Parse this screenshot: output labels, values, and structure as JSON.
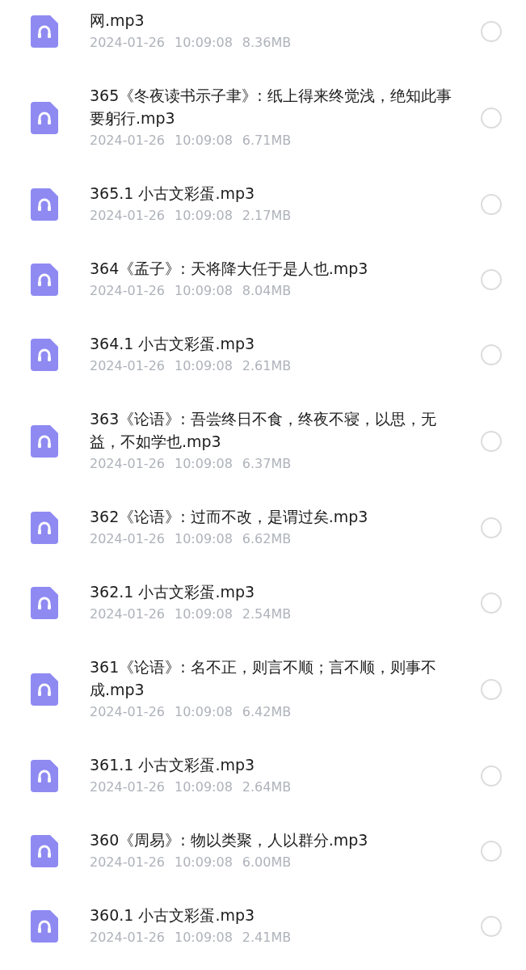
{
  "files": [
    {
      "title": "网.mp3",
      "date": "2024-01-26",
      "time": "10:09:08",
      "size": "8.36MB",
      "selected": false
    },
    {
      "title": "365《冬夜读书示子聿》: 纸上得来终觉浅，绝知此事要躬行.mp3",
      "date": "2024-01-26",
      "time": "10:09:08",
      "size": "6.71MB",
      "selected": false
    },
    {
      "title": "365.1 小古文彩蛋.mp3",
      "date": "2024-01-26",
      "time": "10:09:08",
      "size": "2.17MB",
      "selected": false
    },
    {
      "title": "364《孟子》: 天将降大任于是人也.mp3",
      "date": "2024-01-26",
      "time": "10:09:08",
      "size": "8.04MB",
      "selected": false
    },
    {
      "title": "364.1 小古文彩蛋.mp3",
      "date": "2024-01-26",
      "time": "10:09:08",
      "size": "2.61MB",
      "selected": false
    },
    {
      "title": "363《论语》: 吾尝终日不食，终夜不寝，以思，无益，不如学也.mp3",
      "date": "2024-01-26",
      "time": "10:09:08",
      "size": "6.37MB",
      "selected": false
    },
    {
      "title": "362《论语》: 过而不改，是谓过矣.mp3",
      "date": "2024-01-26",
      "time": "10:09:08",
      "size": "6.62MB",
      "selected": false
    },
    {
      "title": "362.1 小古文彩蛋.mp3",
      "date": "2024-01-26",
      "time": "10:09:08",
      "size": "2.54MB",
      "selected": false
    },
    {
      "title": "361《论语》: 名不正，则言不顺；言不顺，则事不成.mp3",
      "date": "2024-01-26",
      "time": "10:09:08",
      "size": "6.42MB",
      "selected": false
    },
    {
      "title": "361.1 小古文彩蛋.mp3",
      "date": "2024-01-26",
      "time": "10:09:08",
      "size": "2.64MB",
      "selected": false
    },
    {
      "title": "360《周易》: 物以类聚，人以群分.mp3",
      "date": "2024-01-26",
      "time": "10:09:08",
      "size": "6.00MB",
      "selected": false
    },
    {
      "title": "360.1 小古文彩蛋.mp3",
      "date": "2024-01-26",
      "time": "10:09:08",
      "size": "2.41MB",
      "selected": false
    }
  ]
}
